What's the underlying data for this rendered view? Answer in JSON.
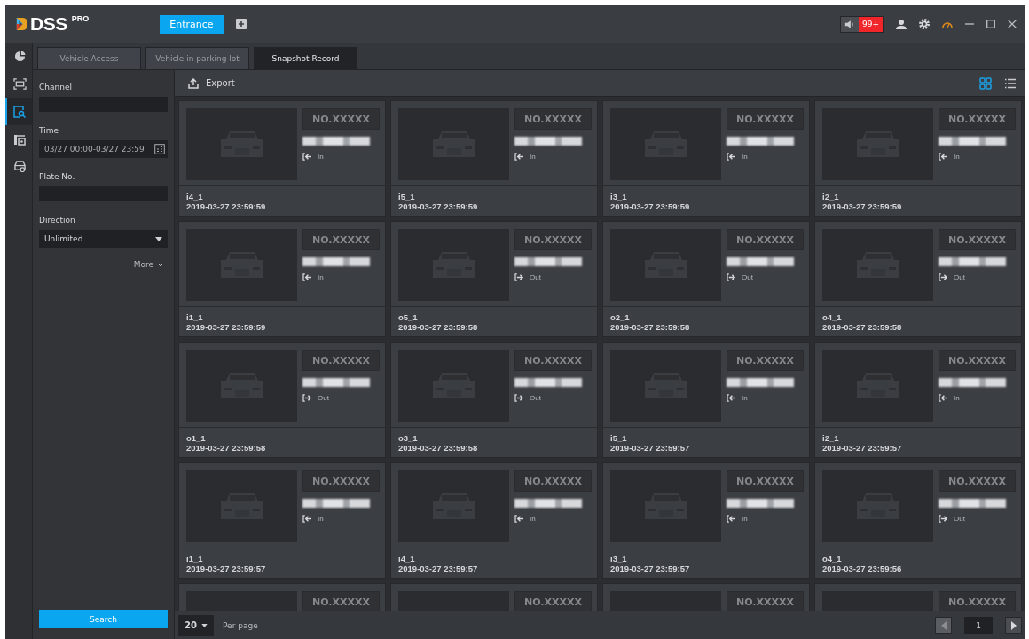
{
  "app": {
    "logo": "DSS",
    "logo_suffix": "PRO",
    "module_tab": "Entrance",
    "alarm_count": "99+"
  },
  "nav_rail": [
    {
      "kind": "pie",
      "selected": false
    },
    {
      "kind": "frame",
      "selected": false
    },
    {
      "kind": "search",
      "selected": true
    },
    {
      "kind": "gate",
      "selected": false
    },
    {
      "kind": "car",
      "selected": false
    }
  ],
  "tabs": [
    {
      "label": "Vehicle Access",
      "selected": false
    },
    {
      "label": "Vehicle in parking lot",
      "selected": false
    },
    {
      "label": "Snapshot Record",
      "selected": true
    }
  ],
  "filters": {
    "channel": {
      "label": "Channel"
    },
    "time": {
      "label": "Time",
      "value": "03/27 00:00-03/27 23:59"
    },
    "plate": {
      "label": "Plate No."
    },
    "direction": {
      "label": "Direction",
      "value": "Unlimited"
    },
    "more": "More",
    "search_button": "Search"
  },
  "toolbar": {
    "export": "Export",
    "views": [
      {
        "kind": "grid",
        "selected": true
      },
      {
        "kind": "list",
        "selected": false
      }
    ]
  },
  "cards": [
    {
      "plate": "NO.XXXXX",
      "kind": "in",
      "direction_label": "In",
      "channel": "i4_1",
      "time": "2019-03-27 23:59:59"
    },
    {
      "plate": "NO.XXXXX",
      "kind": "in",
      "direction_label": "In",
      "channel": "i5_1",
      "time": "2019-03-27 23:59:59"
    },
    {
      "plate": "NO.XXXXX",
      "kind": "in",
      "direction_label": "In",
      "channel": "i3_1",
      "time": "2019-03-27 23:59:59"
    },
    {
      "plate": "NO.XXXXX",
      "kind": "in",
      "direction_label": "In",
      "channel": "i2_1",
      "time": "2019-03-27 23:59:59"
    },
    {
      "plate": "NO.XXXXX",
      "kind": "in",
      "direction_label": "In",
      "channel": "i1_1",
      "time": "2019-03-27 23:59:59"
    },
    {
      "plate": "NO.XXXXX",
      "kind": "out",
      "direction_label": "Out",
      "channel": "o5_1",
      "time": "2019-03-27 23:59:58"
    },
    {
      "plate": "NO.XXXXX",
      "kind": "out",
      "direction_label": "Out",
      "channel": "o2_1",
      "time": "2019-03-27 23:59:58"
    },
    {
      "plate": "NO.XXXXX",
      "kind": "out",
      "direction_label": "Out",
      "channel": "o4_1",
      "time": "2019-03-27 23:59:58"
    },
    {
      "plate": "NO.XXXXX",
      "kind": "out",
      "direction_label": "Out",
      "channel": "o1_1",
      "time": "2019-03-27 23:59:58"
    },
    {
      "plate": "NO.XXXXX",
      "kind": "out",
      "direction_label": "Out",
      "channel": "o3_1",
      "time": "2019-03-27 23:59:58"
    },
    {
      "plate": "NO.XXXXX",
      "kind": "in",
      "direction_label": "In",
      "channel": "i5_1",
      "time": "2019-03-27 23:59:57"
    },
    {
      "plate": "NO.XXXXX",
      "kind": "in",
      "direction_label": "In",
      "channel": "i2_1",
      "time": "2019-03-27 23:59:57"
    },
    {
      "plate": "NO.XXXXX",
      "kind": "in",
      "direction_label": "In",
      "channel": "i1_1",
      "time": "2019-03-27 23:59:57"
    },
    {
      "plate": "NO.XXXXX",
      "kind": "in",
      "direction_label": "In",
      "channel": "i4_1",
      "time": "2019-03-27 23:59:57"
    },
    {
      "plate": "NO.XXXXX",
      "kind": "in",
      "direction_label": "In",
      "channel": "i3_1",
      "time": "2019-03-27 23:59:57"
    },
    {
      "plate": "NO.XXXXX",
      "kind": "out",
      "direction_label": "Out",
      "channel": "o4_1",
      "time": "2019-03-27 23:59:56"
    },
    {
      "plate": "NO.XXXXX"
    },
    {
      "plate": "NO.XXXXX"
    },
    {
      "plate": "NO.XXXXX"
    },
    {
      "plate": "NO.XXXXX"
    }
  ],
  "pagination": {
    "page_size": "20",
    "per_page_label": "Per page",
    "page": "1"
  }
}
